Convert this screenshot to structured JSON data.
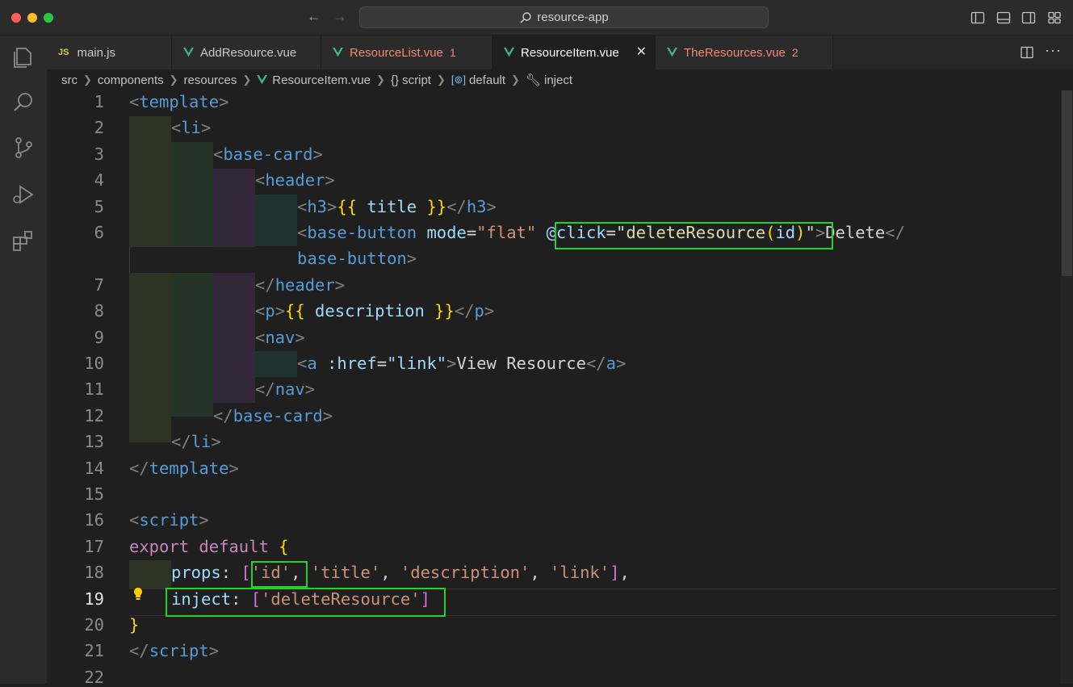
{
  "window": {
    "title": "resource-app",
    "colors": {
      "close": "#ff5f57",
      "minimize": "#febc2e",
      "zoom": "#28c840"
    }
  },
  "tabs": [
    {
      "label": "main.js",
      "icon": "js-icon",
      "icon_text": "JS",
      "error_count": ""
    },
    {
      "label": "AddResource.vue",
      "icon": "vue-icon",
      "error_count": ""
    },
    {
      "label": "ResourceList.vue",
      "icon": "vue-icon",
      "error_count": "1"
    },
    {
      "label": "ResourceItem.vue",
      "icon": "vue-icon",
      "error_count": "",
      "active": true
    },
    {
      "label": "TheResources.vue",
      "icon": "vue-icon",
      "error_count": "2"
    }
  ],
  "breadcrumb": [
    "src",
    "components",
    "resources",
    "ResourceItem.vue",
    "{} script",
    "default",
    "inject"
  ],
  "gutter": {
    "line_numbers": [
      "1",
      "2",
      "3",
      "4",
      "5",
      "6",
      "7",
      "8",
      "9",
      "10",
      "11",
      "12",
      "13",
      "14",
      "15",
      "16",
      "17",
      "18",
      "19",
      "20",
      "21",
      "22"
    ],
    "active_line": "19"
  },
  "code": {
    "l1": [
      "<",
      "template",
      ">"
    ],
    "l2": [
      "<",
      "li",
      ">"
    ],
    "l3": [
      "<",
      "base-card",
      ">"
    ],
    "l4": [
      "<",
      "header",
      ">"
    ],
    "l5": [
      "<",
      "h3",
      ">",
      "{{",
      " title ",
      "}}",
      "</",
      "h3",
      ">"
    ],
    "l6": [
      "<",
      "base-button",
      " ",
      "mode",
      "=",
      "\"flat\"",
      " ",
      "@click",
      "=",
      "\"",
      "deleteResource",
      "(",
      "id",
      ")",
      "\"",
      ">",
      "Delete",
      "</"
    ],
    "l6b": [
      "base-button",
      ">"
    ],
    "l7": [
      "</",
      "header",
      ">"
    ],
    "l8": [
      "<",
      "p",
      ">",
      "{{",
      " description ",
      "}}",
      "</",
      "p",
      ">"
    ],
    "l9": [
      "<",
      "nav",
      ">"
    ],
    "l10": [
      "<",
      "a",
      " ",
      ":href",
      "=",
      "\"link\"",
      ">",
      "View Resource",
      "</",
      "a",
      ">"
    ],
    "l11": [
      "</",
      "nav",
      ">"
    ],
    "l12": [
      "</",
      "base-card",
      ">"
    ],
    "l13": [
      "</",
      "li",
      ">"
    ],
    "l14": [
      "</",
      "template",
      ">"
    ],
    "l16": [
      "<",
      "script",
      ">"
    ],
    "l17": [
      "export",
      " ",
      "default",
      " ",
      "{"
    ],
    "l18": [
      "props",
      ": ",
      "[",
      "'id'",
      ", ",
      "'title'",
      ", ",
      "'description'",
      ", ",
      "'link'",
      "]",
      ","
    ],
    "l19": [
      "inject",
      ": ",
      "[",
      "'deleteResource'",
      "]"
    ],
    "l20": [
      "}"
    ],
    "l21": [
      "</",
      "script",
      ">"
    ]
  },
  "colors": {
    "accent_highlight_box": "#22d22a",
    "vue_green": "#41b883",
    "error_text": "#f48771"
  }
}
